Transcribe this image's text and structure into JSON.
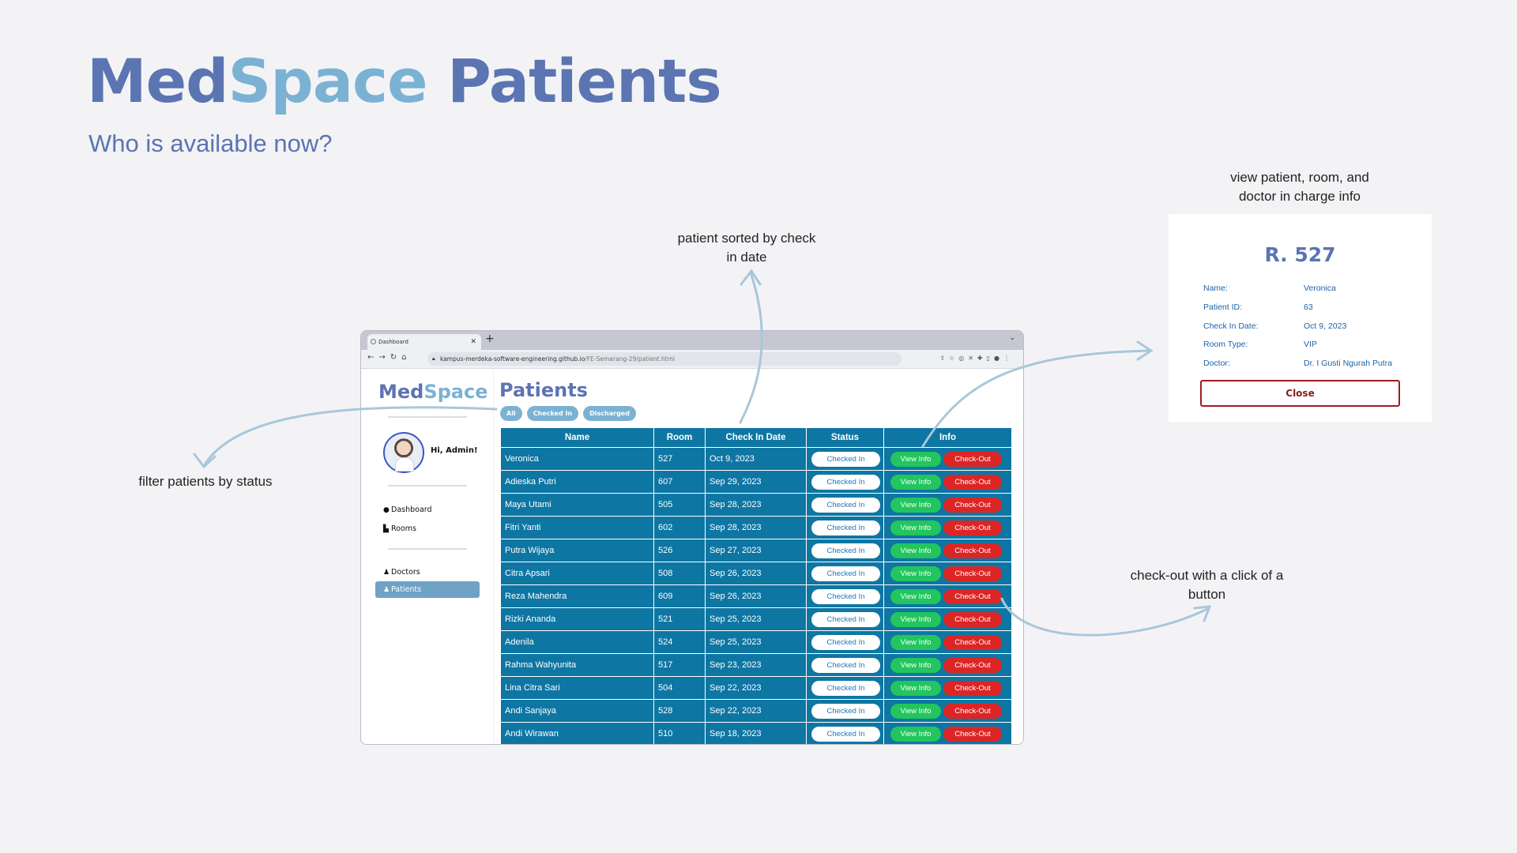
{
  "hero": {
    "brand_a": "Med",
    "brand_b": "Space",
    "brand_c": "Patients",
    "subtitle": "Who is available now?"
  },
  "notes": {
    "filter": "filter patients by status",
    "sorted_line1": "patient sorted by check",
    "sorted_line2": "in date",
    "view_line1": "view patient, room, and",
    "view_line2": "doctor in charge info",
    "checkout_line1": "check-out with a click of a",
    "checkout_line2": "button"
  },
  "browser": {
    "tab_title": "Dashboard",
    "url_host": "kampus-merdeka-software-engineering.github.io",
    "url_path": "/FE-Semarang-29/patient.html"
  },
  "sidebar": {
    "brand_a": "Med",
    "brand_b": "Space",
    "greeting": "Hi, Admin!",
    "items": [
      {
        "label": "Dashboard",
        "icon": "info-icon"
      },
      {
        "label": "Rooms",
        "icon": "bed-icon"
      },
      {
        "label": "Doctors",
        "icon": "person-icon"
      },
      {
        "label": "Patients",
        "icon": "person-icon",
        "active": true
      }
    ]
  },
  "main": {
    "title": "Patients",
    "filters": [
      "All",
      "Checked In",
      "Discharged"
    ],
    "columns": [
      "Name",
      "Room",
      "Check In Date",
      "Status",
      "Info"
    ],
    "status_label": "Checked In",
    "view_label": "View Info",
    "checkout_label": "Check-Out",
    "rows": [
      {
        "name": "Veronica",
        "room": "527",
        "date": "Oct 9, 2023"
      },
      {
        "name": "Adieska Putri",
        "room": "607",
        "date": "Sep 29, 2023"
      },
      {
        "name": "Maya Utami",
        "room": "505",
        "date": "Sep 28, 2023"
      },
      {
        "name": "Fitri Yanti",
        "room": "602",
        "date": "Sep 28, 2023"
      },
      {
        "name": "Putra Wijaya",
        "room": "526",
        "date": "Sep 27, 2023"
      },
      {
        "name": "Citra Apsari",
        "room": "508",
        "date": "Sep 26, 2023"
      },
      {
        "name": "Reza Mahendra",
        "room": "609",
        "date": "Sep 26, 2023"
      },
      {
        "name": "Rizki Ananda",
        "room": "521",
        "date": "Sep 25, 2023"
      },
      {
        "name": "Adenila",
        "room": "524",
        "date": "Sep 25, 2023"
      },
      {
        "name": "Rahma Wahyunita",
        "room": "517",
        "date": "Sep 23, 2023"
      },
      {
        "name": "Lina Citra Sari",
        "room": "504",
        "date": "Sep 22, 2023"
      },
      {
        "name": "Andi Sanjaya",
        "room": "528",
        "date": "Sep 22, 2023"
      },
      {
        "name": "Andi Wirawan",
        "room": "510",
        "date": "Sep 18, 2023"
      }
    ]
  },
  "modal": {
    "title": "R. 527",
    "fields": [
      {
        "label": "Name:",
        "value": "Veronica"
      },
      {
        "label": "Patient ID:",
        "value": "63"
      },
      {
        "label": "Check In Date:",
        "value": "Oct 9, 2023"
      },
      {
        "label": "Room Type:",
        "value": "VIP"
      },
      {
        "label": "Doctor:",
        "value": "Dr. I Gusti Ngurah Putra"
      }
    ],
    "close_label": "Close"
  },
  "colors": {
    "brand_dark": "#5b74b2",
    "brand_light": "#7bb2d3",
    "table": "#0e76a3",
    "view": "#22c55e",
    "checkout": "#dc2626"
  }
}
